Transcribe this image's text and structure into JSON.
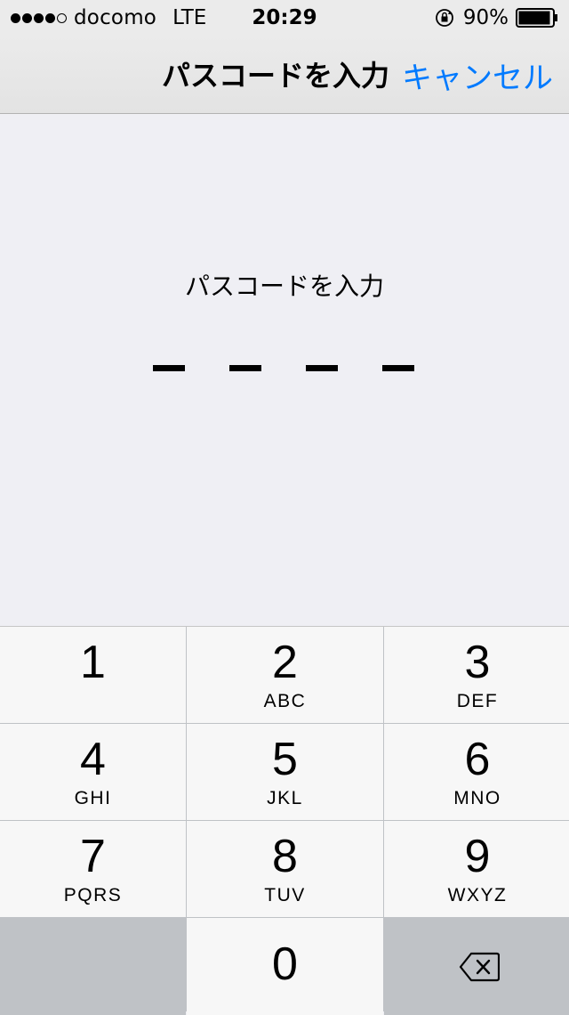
{
  "status_bar": {
    "signal_dots": [
      true,
      true,
      true,
      true,
      false
    ],
    "carrier": "docomo",
    "network": "LTE",
    "time": "20:29",
    "battery": "90%",
    "icons": [
      "signal-icon",
      "rotation-lock-icon",
      "battery-icon"
    ]
  },
  "nav": {
    "title": "パスコードを入力",
    "cancel_label": "キャンセル",
    "accent_color": "#007aff"
  },
  "passcode": {
    "prompt": "パスコードを入力",
    "digit_count": 4
  },
  "keypad": {
    "keys": [
      {
        "num": "1",
        "letters": ""
      },
      {
        "num": "2",
        "letters": "ABC"
      },
      {
        "num": "3",
        "letters": "DEF"
      },
      {
        "num": "4",
        "letters": "GHI"
      },
      {
        "num": "5",
        "letters": "JKL"
      },
      {
        "num": "6",
        "letters": "MNO"
      },
      {
        "num": "7",
        "letters": "PQRS"
      },
      {
        "num": "8",
        "letters": "TUV"
      },
      {
        "num": "9",
        "letters": "WXYZ"
      },
      {
        "num": "0",
        "letters": ""
      }
    ],
    "delete_icon": "delete-backspace-icon"
  }
}
